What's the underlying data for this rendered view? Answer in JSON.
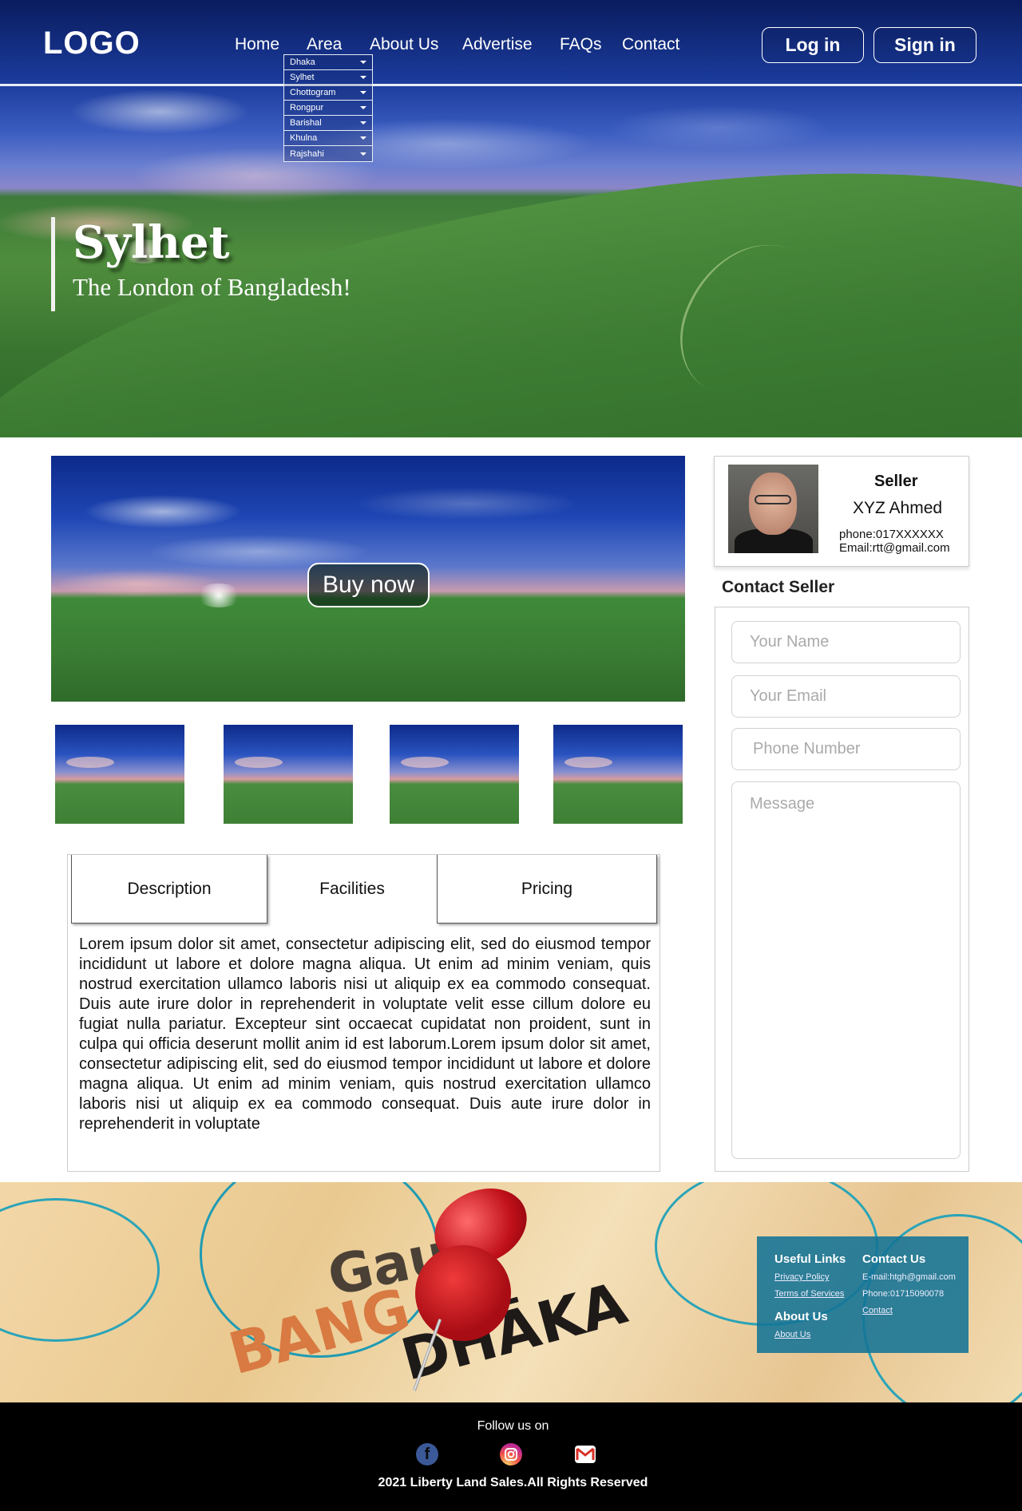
{
  "nav": {
    "logo": "LOGO",
    "links": [
      "Home",
      "Area",
      "About Us",
      "Advertise",
      "FAQs",
      "Contact"
    ],
    "login": "Log in",
    "signin": "Sign in"
  },
  "area_dropdown": [
    "Dhaka",
    "Sylhet",
    "Chottogram",
    "Rongpur",
    "Barishal",
    "Khulna",
    "Rajshahi"
  ],
  "hero": {
    "title": "Sylhet",
    "subtitle": "The London  of Bangladesh!"
  },
  "buy_now": "Buy now",
  "tabs": [
    "Description",
    "Facilities",
    "Pricing"
  ],
  "description": "Lorem ipsum dolor sit amet, consectetur adipiscing elit, sed do eiusmod tempor incididunt ut labore et dolore magna aliqua. Ut enim ad minim veniam, quis nostrud exercitation ullamco laboris nisi ut aliquip ex ea commodo consequat. Duis aute irure dolor in reprehenderit in voluptate velit esse cillum dolore eu fugiat nulla pariatur. Excepteur sint occaecat cupidatat non proident, sunt in culpa qui officia deserunt mollit anim id est laborum.Lorem ipsum dolor sit amet, consectetur adipiscing elit, sed do eiusmod tempor incididunt ut labore et dolore magna aliqua. Ut enim ad minim veniam, quis nostrud exercitation ullamco laboris nisi ut aliquip ex ea commodo consequat. Duis aute irure dolor in reprehenderit in voluptate",
  "seller": {
    "label": "Seller",
    "name": "XYZ Ahmed",
    "phone": "phone:017XXXXXX",
    "email": "Email:rtt@gmail.com"
  },
  "contact_form": {
    "title": "Contact Seller",
    "name_placeholder": "Your Name",
    "email_placeholder": "Your Email",
    "phone_placeholder": "Phone Number",
    "message_placeholder": "Message"
  },
  "map_labels": {
    "city": "DHĀKA",
    "region": "BANG",
    "town": "Gauh"
  },
  "footer_links": {
    "useful_links_title": "Useful Links",
    "privacy": "Privacy Policy",
    "terms": "Terms of Services",
    "about_title": "About Us",
    "about_link": "About Us",
    "contact_title": "Contact Us",
    "email": "E-mail:htgh@gmail.com",
    "phone": "Phone:01715090078",
    "contact_link": "Contact"
  },
  "footer": {
    "follow": "Follow us on",
    "copyright": "2021  Liberty  Land Sales.All Rights Reserved"
  },
  "icons": [
    "facebook-icon",
    "instagram-icon",
    "gmail-icon"
  ],
  "colors": {
    "nav_border": "#e8ecf5",
    "footer_bg": "#000000",
    "links_box": "#12739a"
  }
}
